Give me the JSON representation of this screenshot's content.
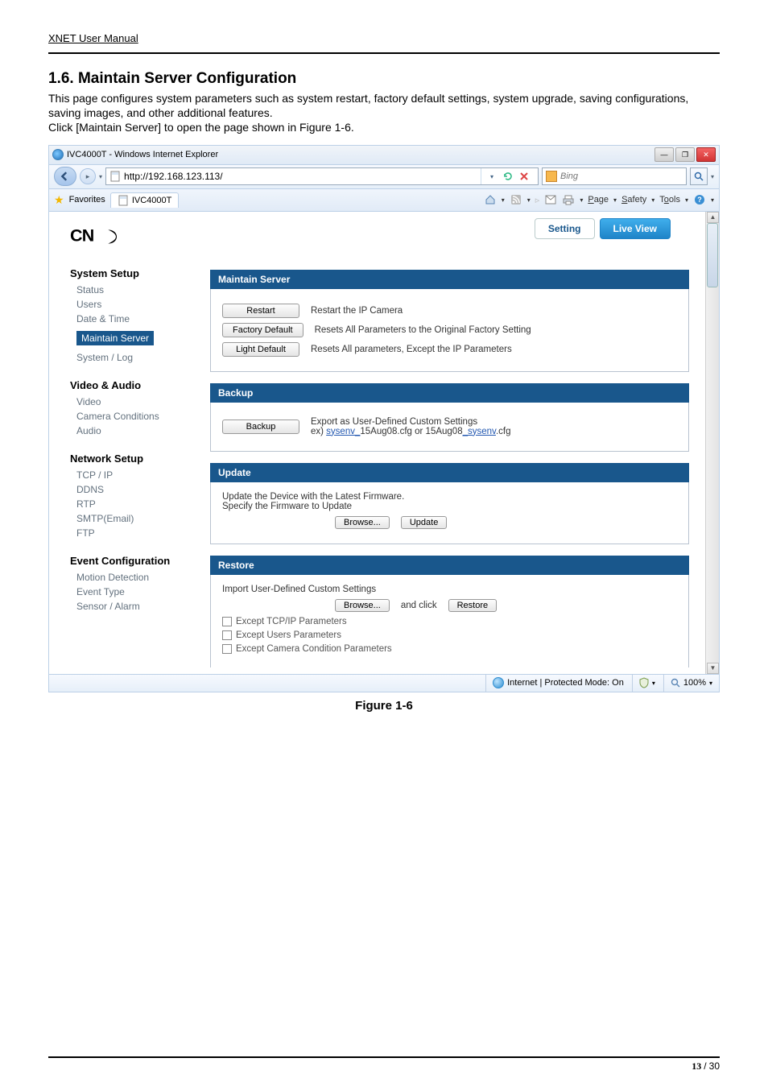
{
  "doc_header": "XNET User Manual",
  "section": {
    "number": "1.6.  Maintain Server Configuration",
    "desc": "This page configures system parameters such as system restart, factory default settings, system upgrade, saving configurations, saving images, and other additional features.\nClick [Maintain Server] to open the page shown in Figure 1-6.",
    "figcap": "Figure 1-6"
  },
  "browser": {
    "title": "IVC4000T - Windows Internet Explorer",
    "url": "http://192.168.123.113/",
    "search_placeholder": "Bing",
    "favorites": "Favorites",
    "tab": "IVC4000T",
    "cmd": {
      "page": "Page",
      "safety": "Safety",
      "tools": "Tools"
    },
    "status": {
      "mode": "Internet | Protected Mode: On",
      "zoom": "100%"
    }
  },
  "nav": {
    "setting": "Setting",
    "live": "Live View"
  },
  "sidebar": {
    "system": {
      "head": "System Setup",
      "items": [
        "Status",
        "Users",
        "Date & Time",
        "Maintain Server",
        "System / Log"
      ]
    },
    "va": {
      "head": "Video & Audio",
      "items": [
        "Video",
        "Camera Conditions",
        "Audio"
      ]
    },
    "net": {
      "head": "Network Setup",
      "items": [
        "TCP / IP",
        "DDNS",
        "RTP",
        "SMTP(Email)",
        "FTP"
      ]
    },
    "evt": {
      "head": "Event Configuration",
      "items": [
        "Motion Detection",
        "Event Type",
        "Sensor / Alarm"
      ]
    }
  },
  "panels": {
    "maintain": {
      "title": "Maintain Server",
      "restart_btn": "Restart",
      "restart_lbl": "Restart the IP Camera",
      "factdef_btn": "Factory Default",
      "factdef_lbl": "Resets All Parameters to the Original Factory Setting",
      "lightdef_btn": "Light Default",
      "lightdef_lbl": "Resets All parameters, Except the IP Parameters"
    },
    "backup": {
      "title": "Backup",
      "btn": "Backup",
      "lbl1": "Export as User-Defined Custom Settings",
      "lbl2_pre": "ex) ",
      "lbl2_link1": "sysenv_",
      "lbl2_mid1": "15Aug08.cfg or 15Aug08",
      "lbl2_link2": "_sysenv",
      "lbl2_post": ".cfg"
    },
    "update": {
      "title": "Update",
      "desc": "Update the Device with the Latest Firmware.",
      "spec": "Specify the Firmware to Update",
      "browse": "Browse...",
      "update": "Update"
    },
    "restore": {
      "title": "Restore",
      "desc": "Import User-Defined Custom Settings",
      "browse": "Browse...",
      "andclick": "and click",
      "restore": "Restore",
      "c1": "Except TCP/IP Parameters",
      "c2": "Except Users Parameters",
      "c3": "Except Camera Condition Parameters"
    }
  },
  "footer": {
    "cur": "13",
    "sep": " / ",
    "total": "30"
  }
}
